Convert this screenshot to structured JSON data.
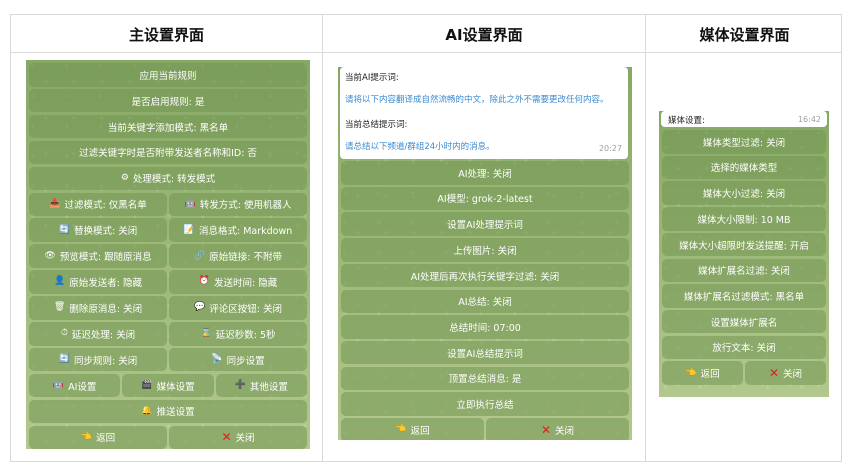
{
  "columns": {
    "main": "主设置界面",
    "ai": "AI设置界面",
    "media": "媒体设置界面"
  },
  "main_panel": {
    "rows": [
      [
        {
          "label": "应用当前规则"
        }
      ],
      [
        {
          "label": "是否启用规则: 是"
        }
      ],
      [
        {
          "label": "当前关键字添加模式: 黑名单"
        }
      ],
      [
        {
          "label": "过滤关键字时是否附带发送者名称和ID: 否"
        }
      ],
      [
        {
          "label": "处理模式: 转发模式",
          "icon": "gear-icon",
          "glyph": "⚙"
        }
      ],
      [
        {
          "label": "过滤模式: 仅黑名单",
          "icon": "inbox-icon",
          "glyph": "📥"
        },
        {
          "label": "转发方式: 使用机器人",
          "icon": "robot-icon",
          "glyph": "🤖"
        }
      ],
      [
        {
          "label": "替换模式: 关闭",
          "icon": "refresh-icon",
          "glyph": "🔄"
        },
        {
          "label": "消息格式: Markdown",
          "icon": "pencil-icon",
          "glyph": "📝"
        }
      ],
      [
        {
          "label": "预览模式: 跟随原消息",
          "icon": "eye-icon",
          "glyph": "👁"
        },
        {
          "label": "原始链接: 不附带",
          "icon": "link-icon",
          "glyph": "🔗"
        }
      ],
      [
        {
          "label": "原始发送者: 隐藏",
          "icon": "user-icon",
          "glyph": "👤"
        },
        {
          "label": "发送时间: 隐藏",
          "icon": "clock-icon",
          "glyph": "⏰"
        }
      ],
      [
        {
          "label": "删除原消息: 关闭",
          "icon": "trash-icon",
          "glyph": "🗑"
        },
        {
          "label": "评论区按钮: 关闭",
          "icon": "comment-icon",
          "glyph": "💬"
        }
      ],
      [
        {
          "label": "延迟处理: 关闭",
          "icon": "timer-icon",
          "glyph": "⏱"
        },
        {
          "label": "延迟秒数: 5秒",
          "icon": "hourglass-icon",
          "glyph": "⌛"
        }
      ],
      [
        {
          "label": "同步规则: 关闭",
          "icon": "sync-icon",
          "glyph": "🔄"
        },
        {
          "label": "同步设置",
          "icon": "satellite-icon",
          "glyph": "📡"
        }
      ],
      [
        {
          "label": "AI设置",
          "icon": "robot-icon",
          "glyph": "🤖"
        },
        {
          "label": "媒体设置",
          "icon": "clapper-icon",
          "glyph": "🎬"
        },
        {
          "label": "其他设置",
          "icon": "plus-icon",
          "glyph": "➕"
        }
      ],
      [
        {
          "label": "推送设置",
          "icon": "bell-icon",
          "glyph": "🔔"
        }
      ],
      [
        {
          "label": "返回",
          "icon": "back-hand-icon",
          "glyph": "👈"
        },
        {
          "label": "关闭",
          "icon": "close-icon",
          "glyph": "✕",
          "red": true
        }
      ]
    ]
  },
  "ai_panel": {
    "message": {
      "prompt_label": "当前AI提示词:",
      "prompt_value": "请将以下内容翻译成自然流畅的中文，除此之外不需要更改任何内容。",
      "summary_label": "当前总结提示词:",
      "summary_value": "请总结以下频道/群组24小时内的消息。",
      "time": "20:27"
    },
    "rows": [
      [
        {
          "label": "AI处理: 关闭"
        }
      ],
      [
        {
          "label": "AI模型: grok-2-latest"
        }
      ],
      [
        {
          "label": "设置AI处理提示词"
        }
      ],
      [
        {
          "label": "上传图片: 关闭"
        }
      ],
      [
        {
          "label": "AI处理后再次执行关键字过滤: 关闭"
        }
      ],
      [
        {
          "label": "AI总结: 关闭"
        }
      ],
      [
        {
          "label": "总结时间: 07:00"
        }
      ],
      [
        {
          "label": "设置AI总结提示词"
        }
      ],
      [
        {
          "label": "顶置总结消息: 是"
        }
      ],
      [
        {
          "label": "立即执行总结"
        }
      ],
      [
        {
          "label": "返回",
          "icon": "back-hand-icon",
          "glyph": "👈"
        },
        {
          "label": "关闭",
          "icon": "close-icon",
          "glyph": "✕",
          "red": true
        }
      ]
    ]
  },
  "media_panel": {
    "message": {
      "label": "媒体设置:",
      "time": "16:42"
    },
    "rows": [
      [
        {
          "label": "媒体类型过滤: 关闭"
        }
      ],
      [
        {
          "label": "选择的媒体类型"
        }
      ],
      [
        {
          "label": "媒体大小过滤: 关闭"
        }
      ],
      [
        {
          "label": "媒体大小限制: 10 MB"
        }
      ],
      [
        {
          "label": "媒体大小超限时发送提醒: 开启"
        }
      ],
      [
        {
          "label": "媒体扩展名过滤: 关闭"
        }
      ],
      [
        {
          "label": "媒体扩展名过滤模式: 黑名单"
        }
      ],
      [
        {
          "label": "设置媒体扩展名"
        }
      ],
      [
        {
          "label": "放行文本: 关闭"
        }
      ],
      [
        {
          "label": "返回",
          "icon": "back-hand-icon",
          "glyph": "👈"
        },
        {
          "label": "关闭",
          "icon": "close-icon",
          "glyph": "✕",
          "red": true
        }
      ]
    ]
  }
}
